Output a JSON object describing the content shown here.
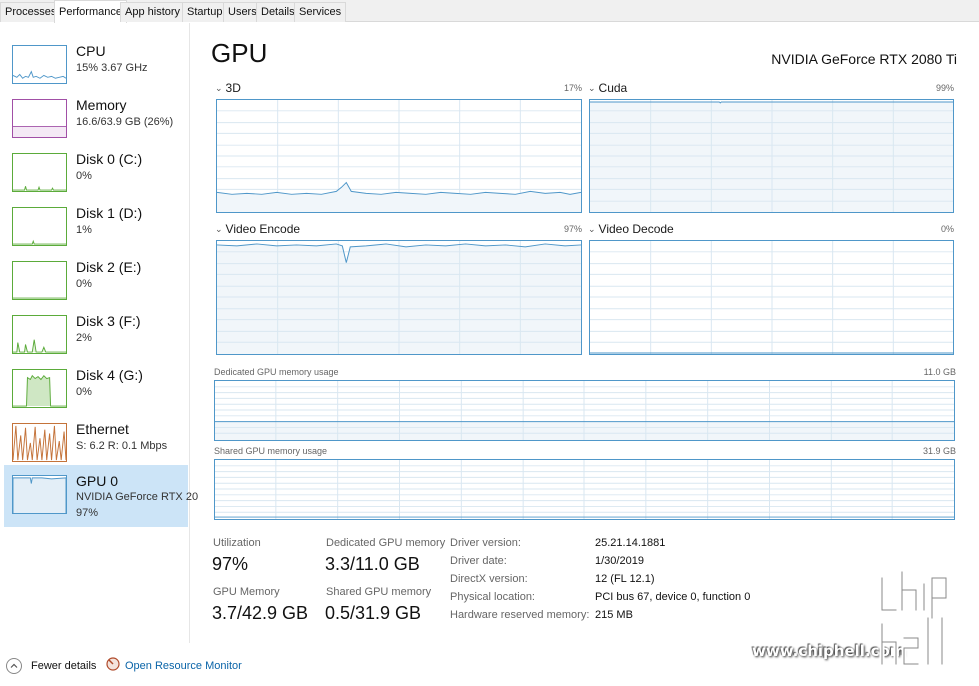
{
  "tabs": [
    {
      "label": "Processes",
      "active": false
    },
    {
      "label": "Performance",
      "active": true
    },
    {
      "label": "App history",
      "active": false
    },
    {
      "label": "Startup",
      "active": false
    },
    {
      "label": "Users",
      "active": false
    },
    {
      "label": "Details",
      "active": false
    },
    {
      "label": "Services",
      "active": false
    }
  ],
  "sidebar": {
    "items": [
      {
        "name": "CPU",
        "sub1": "15%  3.67 GHz",
        "sub2": "",
        "color": "#4f97c9",
        "selected": false
      },
      {
        "name": "Memory",
        "sub1": "16.6/63.9 GB (26%)",
        "sub2": "",
        "color": "#a14fa6",
        "selected": false
      },
      {
        "name": "Disk 0 (C:)",
        "sub1": "0%",
        "sub2": "",
        "color": "#5bab3a",
        "selected": false
      },
      {
        "name": "Disk 1 (D:)",
        "sub1": "1%",
        "sub2": "",
        "color": "#5bab3a",
        "selected": false
      },
      {
        "name": "Disk 2 (E:)",
        "sub1": "0%",
        "sub2": "",
        "color": "#5bab3a",
        "selected": false
      },
      {
        "name": "Disk 3 (F:)",
        "sub1": "2%",
        "sub2": "",
        "color": "#5bab3a",
        "selected": false
      },
      {
        "name": "Disk 4 (G:)",
        "sub1": "0%",
        "sub2": "",
        "color": "#5bab3a",
        "selected": false
      },
      {
        "name": "Ethernet",
        "sub1": "S: 6.2  R: 0.1 Mbps",
        "sub2": "",
        "color": "#c4733a",
        "selected": false
      },
      {
        "name": "GPU 0",
        "sub1": "NVIDIA GeForce RTX 20",
        "sub2": "97%",
        "color": "#4f97c9",
        "selected": true
      }
    ]
  },
  "main": {
    "title": "GPU",
    "model": "NVIDIA GeForce RTX 2080 Ti",
    "engines": [
      {
        "label": "3D",
        "percent": "17%"
      },
      {
        "label": "Cuda",
        "percent": "99%"
      },
      {
        "label": "Video Encode",
        "percent": "97%"
      },
      {
        "label": "Video Decode",
        "percent": "0%"
      }
    ],
    "dedicated": {
      "label": "Dedicated GPU memory usage",
      "capacity": "11.0 GB"
    },
    "shared": {
      "label": "Shared GPU memory usage",
      "capacity": "31.9 GB"
    }
  },
  "stats": {
    "utilization_label": "Utilization",
    "utilization_value": "97%",
    "dedicated_label": "Dedicated GPU memory",
    "dedicated_value": "3.3/11.0 GB",
    "gpu_memory_label": "GPU Memory",
    "gpu_memory_value": "3.7/42.9 GB",
    "shared_label": "Shared GPU memory",
    "shared_value": "0.5/31.9 GB"
  },
  "info": [
    {
      "key": "Driver version:",
      "value": "25.21.14.1881"
    },
    {
      "key": "Driver date:",
      "value": "1/30/2019"
    },
    {
      "key": "DirectX version:",
      "value": "12 (FL 12.1)"
    },
    {
      "key": "Physical location:",
      "value": "PCI bus 67, device 0, function 0"
    },
    {
      "key": "Hardware reserved memory:",
      "value": "215 MB"
    }
  ],
  "footer": {
    "fewer_details": "Fewer details",
    "open_resource_monitor": "Open Resource Monitor"
  },
  "watermark": {
    "url": "www.chiphell.com",
    "logo_text": "chip hell"
  },
  "colors": {
    "gpu_line": "#4f97c9",
    "gpu_fill": "#f1f6fa",
    "grid": "#d9e7f1",
    "selected_bg": "#cce4f7",
    "link": "#0a64a8"
  }
}
